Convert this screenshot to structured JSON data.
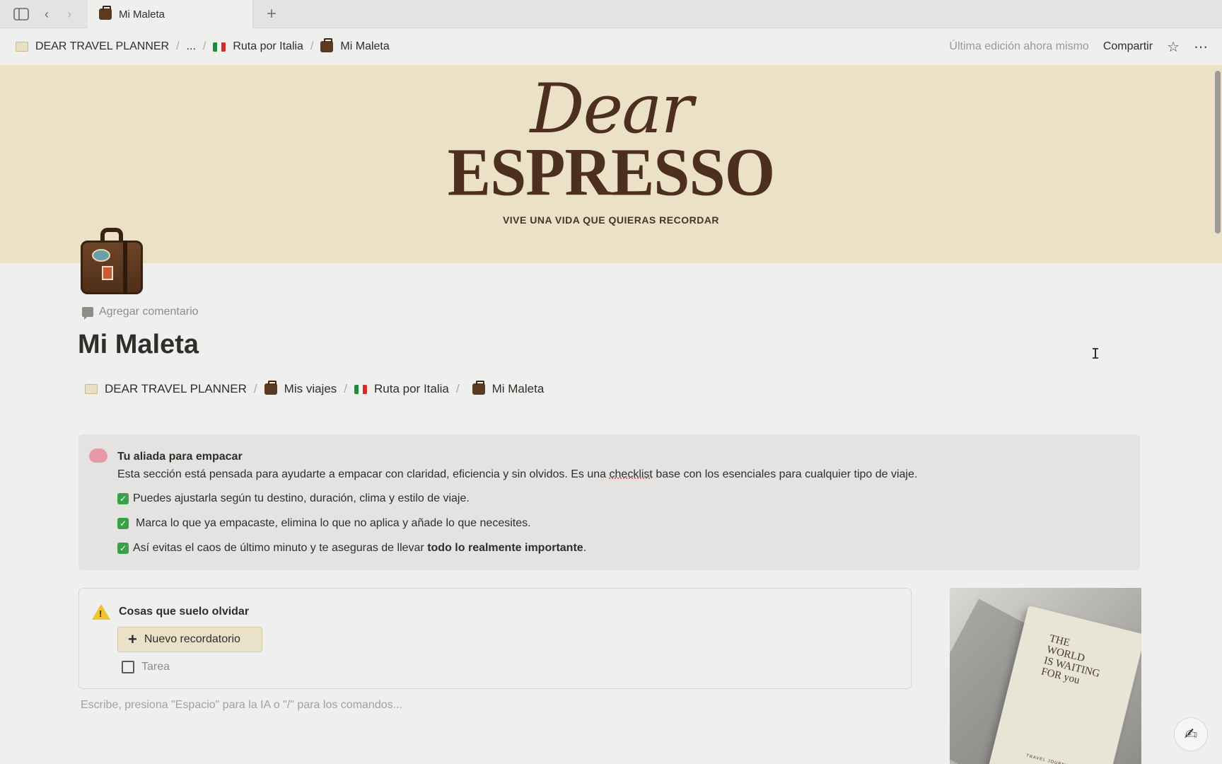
{
  "tab": {
    "title": "Mi Maleta"
  },
  "breadcrumb": {
    "items": [
      "DEAR TRAVEL PLANNER",
      "...",
      "Ruta por Italia",
      "Mi Maleta"
    ],
    "separator": "/"
  },
  "header": {
    "edited": "Última edición ahora mismo",
    "share": "Compartir"
  },
  "cover": {
    "brand_script": "Dear",
    "brand_main": "ESPRESSO",
    "tagline": "VIVE UNA VIDA QUE QUIERAS RECORDAR"
  },
  "page": {
    "add_comment": "Agregar comentario",
    "title": "Mi Maleta",
    "inline_breadcrumb": [
      "DEAR TRAVEL PLANNER",
      "Mis viajes",
      "Ruta por Italia",
      "Mi Maleta"
    ]
  },
  "callout": {
    "title": "Tu aliada para empacar",
    "text_pre": "Esta sección está pensada para ayudarte a empacar con claridad, eficiencia y sin olvidos. Es una ",
    "text_word": "checklist",
    "text_post": " base con los esenciales para cualquier tipo de viaje.",
    "check1": "Puedes ajustarla según tu destino, duración, clima y estilo de viaje.",
    "check2": "Marca lo que ya empacaste, elimina lo que no aplica y añade lo que necesites.",
    "check3_pre": "Así evitas el caos de último minuto y te aseguras de llevar ",
    "check3_bold": "todo lo realmente importante",
    "check3_post": "."
  },
  "reminders": {
    "title": "Cosas que suelo olvidar",
    "new_button": "Nuevo recordatorio",
    "task_label": "Tarea"
  },
  "editor": {
    "placeholder": "Escribe, presiona \"Espacio\" para la IA o \"/\" para los comandos..."
  },
  "photo": {
    "book_line1": "THE",
    "book_line2": "WORLD",
    "book_line3": "IS WAITING",
    "book_line4": "FOR you",
    "book_footer": "TRAVEL JOURNAL"
  },
  "icons": {
    "sidebar_toggle": "sidebar-icon",
    "back": "chevron-left-icon",
    "forward": "chevron-right-icon",
    "new_tab": "plus-icon",
    "favorite": "star-icon",
    "more": "more-icon",
    "help": "help-icon"
  },
  "colors": {
    "cover_bg": "#ebe1c6",
    "brand": "#4d2f1f",
    "callout_bg": "#e4e3e1",
    "check": "#3aa14a"
  }
}
